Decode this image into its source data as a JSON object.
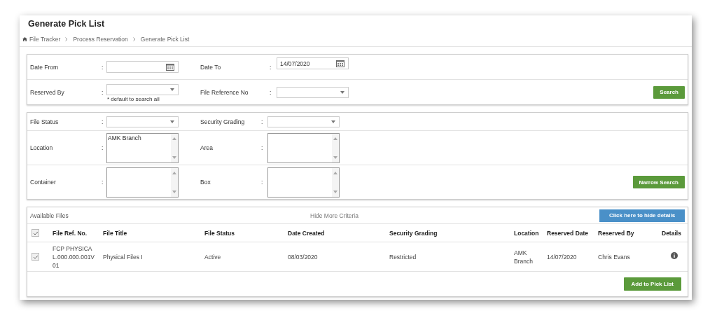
{
  "title": "Generate Pick List",
  "breadcrumb": [
    {
      "label": "File Tracker",
      "home": true
    },
    {
      "label": "Process Reservation",
      "home": false
    },
    {
      "label": "Generate Pick List",
      "home": false
    }
  ],
  "search_panel": {
    "rows": [
      [
        {
          "label": "Date From",
          "colon": ":",
          "kind": "date"
        },
        {
          "label": "Date To",
          "colon": ":",
          "kind": "date",
          "value": "14/07/2020"
        }
      ],
      [
        {
          "label": "Reserved By",
          "colon": ":",
          "kind": "select",
          "note": "* default to search all"
        },
        {
          "label": "File Reference No",
          "colon": ":",
          "kind": "select"
        }
      ]
    ],
    "button": "Search"
  },
  "more_criteria": {
    "rows": [
      [
        {
          "label": "File Status",
          "colon": ":",
          "kind": "select"
        },
        {
          "label": "Security Grading",
          "colon": ":",
          "kind": "select"
        }
      ],
      [
        {
          "label": "Location",
          "colon": ":",
          "kind": "listbox",
          "value": "AMK Branch"
        },
        {
          "label": "Area",
          "colon": ":",
          "kind": "listbox"
        }
      ],
      [
        {
          "label": "Container",
          "colon": ":",
          "kind": "listbox"
        },
        {
          "label": "Box",
          "colon": ":",
          "kind": "listbox"
        }
      ]
    ],
    "button": "Narrow Search"
  },
  "available_files": {
    "title": "Available Files",
    "toggle_link": "Hide More Criteria",
    "details_button": "Click here to hide details",
    "all_checked": true,
    "columns": [
      "File Ref. No.",
      "File Title",
      "File Status",
      "Date Created",
      "Security Grading",
      "Location",
      "Reserved Date",
      "Reserved By",
      "Details"
    ],
    "rows": [
      {
        "checked": true,
        "cells": [
          "FCP PHYSICAL.000.000.001V01",
          "Physical Files I",
          "Active",
          "08/03/2020",
          "Restricted",
          "AMK Branch",
          "14/07/2020",
          "Chris Evans"
        ]
      }
    ],
    "add_button": "Add to Pick List"
  }
}
